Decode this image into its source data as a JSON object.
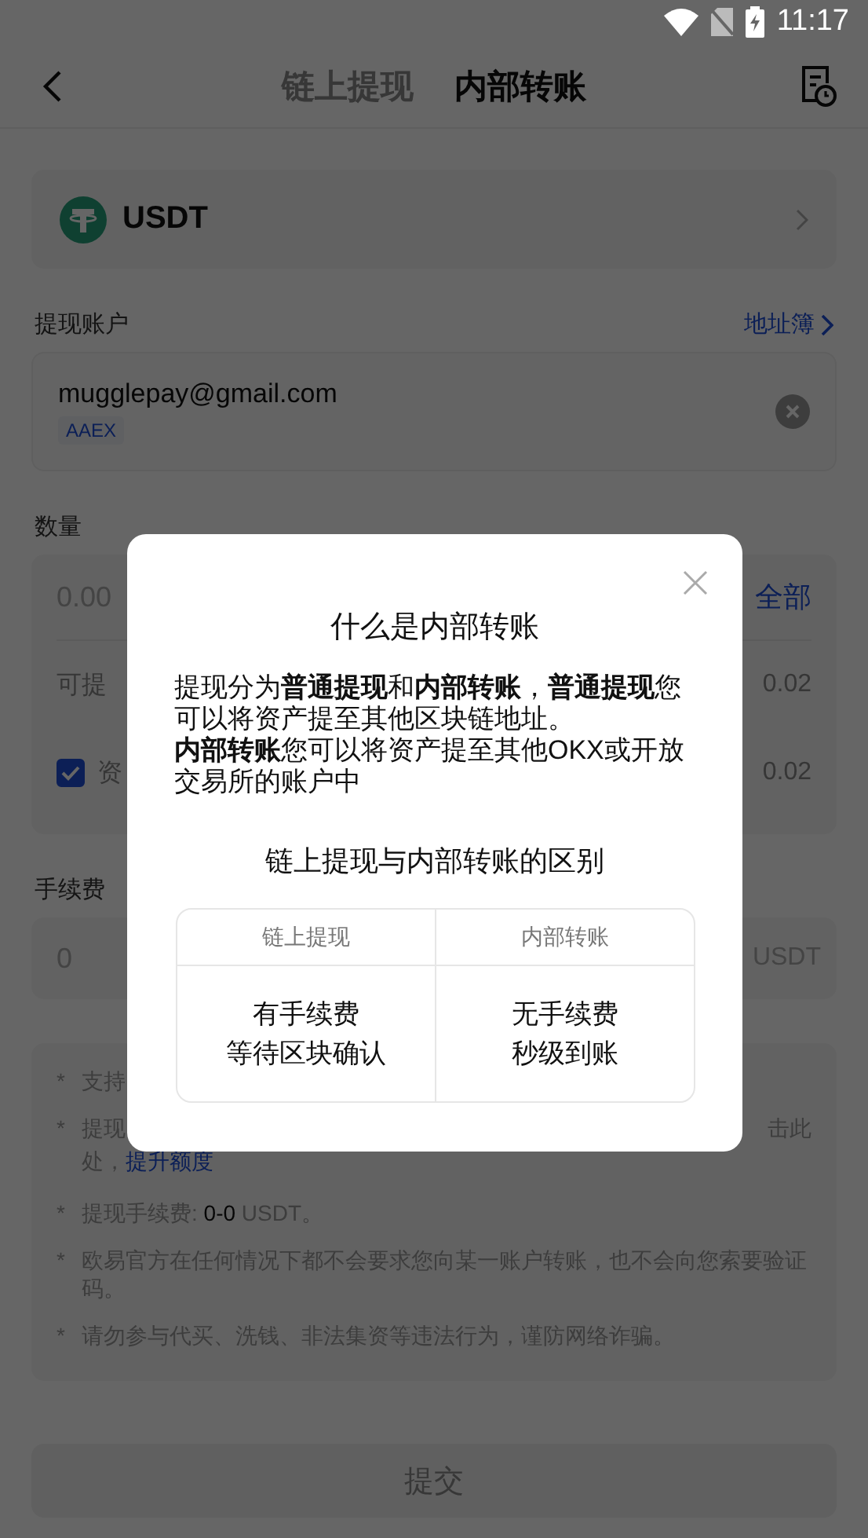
{
  "status_bar": {
    "time": "11:17"
  },
  "header": {
    "tabs": [
      {
        "label": "链上提现",
        "selected": false
      },
      {
        "label": "内部转账",
        "selected": true
      }
    ]
  },
  "coin": {
    "name": "USDT"
  },
  "account": {
    "label": "提现账户",
    "address_book": "地址簿",
    "value": "mugglepay@gmail.com",
    "tag": "AAEX"
  },
  "amount": {
    "label": "数量",
    "placeholder": "0.00",
    "max_link": "全部",
    "available_label": "可提",
    "available_value": "0.02",
    "funding_label": "资",
    "funding_checked": true,
    "funding_value": "0.02"
  },
  "fee": {
    "label": "手续费",
    "value": "0",
    "unit": "USDT"
  },
  "notes": [
    {
      "marker": "*",
      "text": "支持"
    },
    {
      "marker": "*",
      "text": "提现",
      "text_right": "击此",
      "continuation": "处，",
      "link": "提升额度"
    },
    {
      "marker": "*",
      "text": "提现手续费: **0-0** USDT。"
    },
    {
      "marker": "*",
      "text": "欧易官方在任何情况下都不会要求您向某一账户转账，也不会向您索要验证码。"
    },
    {
      "marker": "*",
      "text": "请勿参与代买、洗钱、非法集资等违法行为，谨防网络诈骗。"
    }
  ],
  "submit": {
    "label": "提交",
    "disabled": true
  },
  "dialog": {
    "title": "什么是内部转账",
    "paragraphs": [
      "提现分为**普通提现**和**内部转账**，**普通提现**您可以将资产提至其他区块链地址。",
      "**内部转账**您可以将资产提至其他OKX或开放交易所的账户中"
    ],
    "subtitle": "链上提现与内部转账的区别",
    "table": {
      "columns": [
        "链上提现",
        "内部转账"
      ],
      "rows": [
        [
          [
            "有手续费",
            "等待区块确认"
          ],
          [
            "无手续费",
            "秒级到账"
          ]
        ]
      ]
    }
  }
}
